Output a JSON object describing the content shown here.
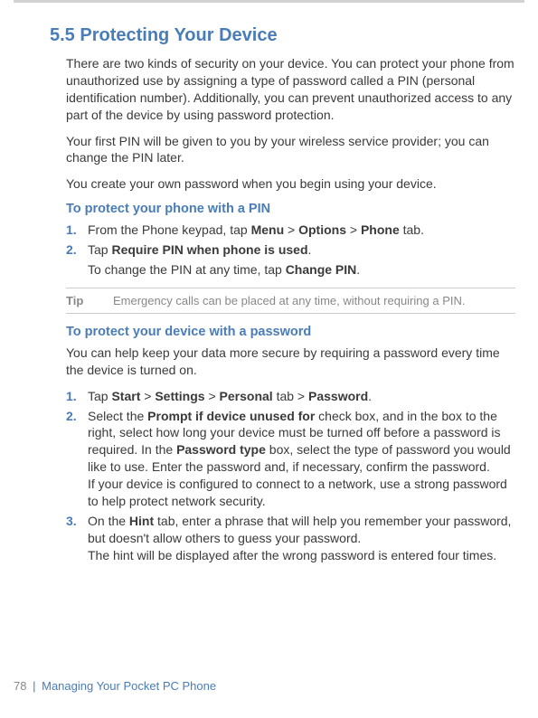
{
  "heading": "5.5 Protecting Your Device",
  "intro1": "There are two kinds of security on your device. You can protect your phone from unauthorized use by assigning a type of password called a PIN (personal identification number). Additionally, you can prevent unauthorized access to any part of the device by using password protection.",
  "intro2": "Your first PIN will be given to you by your wireless service provider; you can change the PIN later.",
  "intro3": "You create your own password when you begin using your device.",
  "sub1": "To protect your phone with a PIN",
  "pin_steps": [
    {
      "num": "1.",
      "html": "From the Phone keypad, tap <b>Menu</b> > <b>Options</b> > <b>Phone</b> tab."
    },
    {
      "num": "2.",
      "html": "Tap <b>Require PIN when phone is used</b>."
    }
  ],
  "pin_note_html": "To change the PIN at any time, tap <b>Change PIN</b>.",
  "tip_label": "Tip",
  "tip_text": "Emergency calls can be placed at any time, without requiring a PIN.",
  "sub2": "To protect your device with a password",
  "pwd_intro": "You can help keep your data more secure by requiring a password every time the device is turned on.",
  "pwd_steps": [
    {
      "num": "1.",
      "html": "Tap <b>Start</b> > <b>Settings</b> > <b>Personal</b> tab > <b>Password</b>."
    },
    {
      "num": "2.",
      "html": "Select the <b>Prompt if device unused for</b> check box, and in the box to the right, select how long your device must be turned off before a password is required. In the <b>Password type</b> box, select the type of password you would like to use. Enter the password and, if necessary, confirm the password.<br>If your device is configured to connect to a network, use a strong password to help protect network security."
    },
    {
      "num": "3.",
      "html": "On the <b>Hint</b> tab, enter a phrase that will help you remember your password, but doesn't allow others to guess your password.<br>The hint will be displayed after the wrong password is entered four times."
    }
  ],
  "footer": {
    "page": "78",
    "divider": "|",
    "text": "Managing Your Pocket PC Phone"
  }
}
